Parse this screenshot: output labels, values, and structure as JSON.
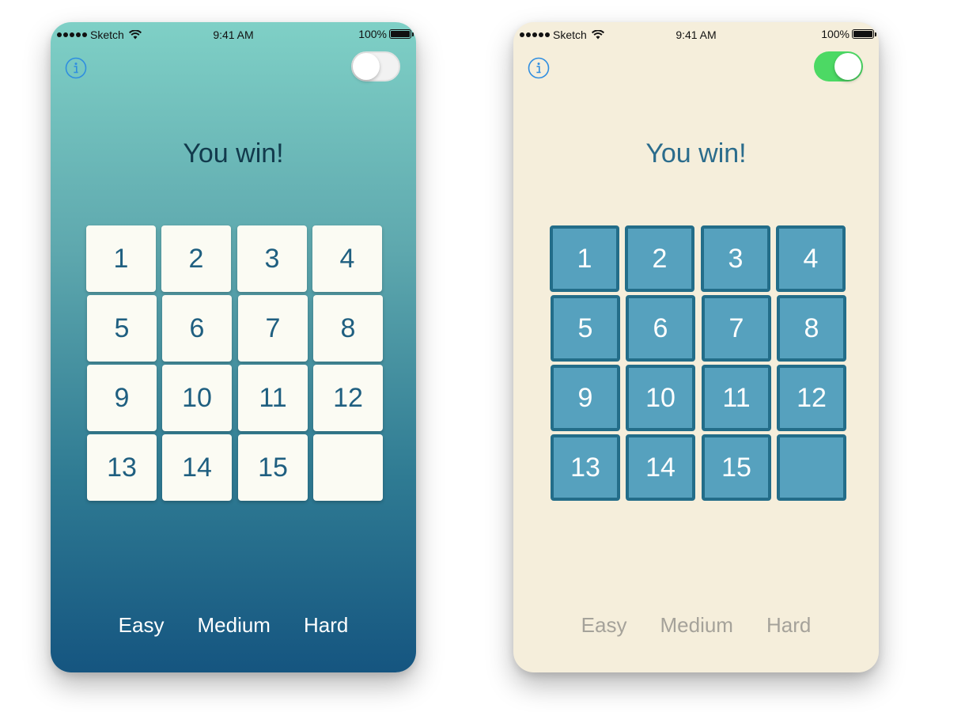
{
  "screens": [
    {
      "theme": "dark",
      "status": {
        "carrier": "Sketch",
        "time": "9:41 AM",
        "battery": "100%"
      },
      "toggle_on": false,
      "title": "You win!",
      "tiles": [
        "1",
        "2",
        "3",
        "4",
        "5",
        "6",
        "7",
        "8",
        "9",
        "10",
        "11",
        "12",
        "13",
        "14",
        "15",
        ""
      ],
      "difficulty": [
        "Easy",
        "Medium",
        "Hard"
      ],
      "colors": {
        "gradient_top": "#7fd0c6",
        "gradient_bottom": "#155580",
        "tile": "#fbfbf3",
        "tile_text": "#1f5f80",
        "info_icon": "#2f8ee0"
      }
    },
    {
      "theme": "light",
      "status": {
        "carrier": "Sketch",
        "time": "9:41 AM",
        "battery": "100%"
      },
      "toggle_on": true,
      "title": "You win!",
      "tiles": [
        "1",
        "2",
        "3",
        "4",
        "5",
        "6",
        "7",
        "8",
        "9",
        "10",
        "11",
        "12",
        "13",
        "14",
        "15",
        ""
      ],
      "difficulty": [
        "Easy",
        "Medium",
        "Hard"
      ],
      "colors": {
        "background": "#f5eedb",
        "tile": "#56a1be",
        "tile_border": "#236d89",
        "tile_text": "#ffffff",
        "toggle": "#4cd964",
        "info_icon": "#2f8ee0"
      }
    }
  ]
}
